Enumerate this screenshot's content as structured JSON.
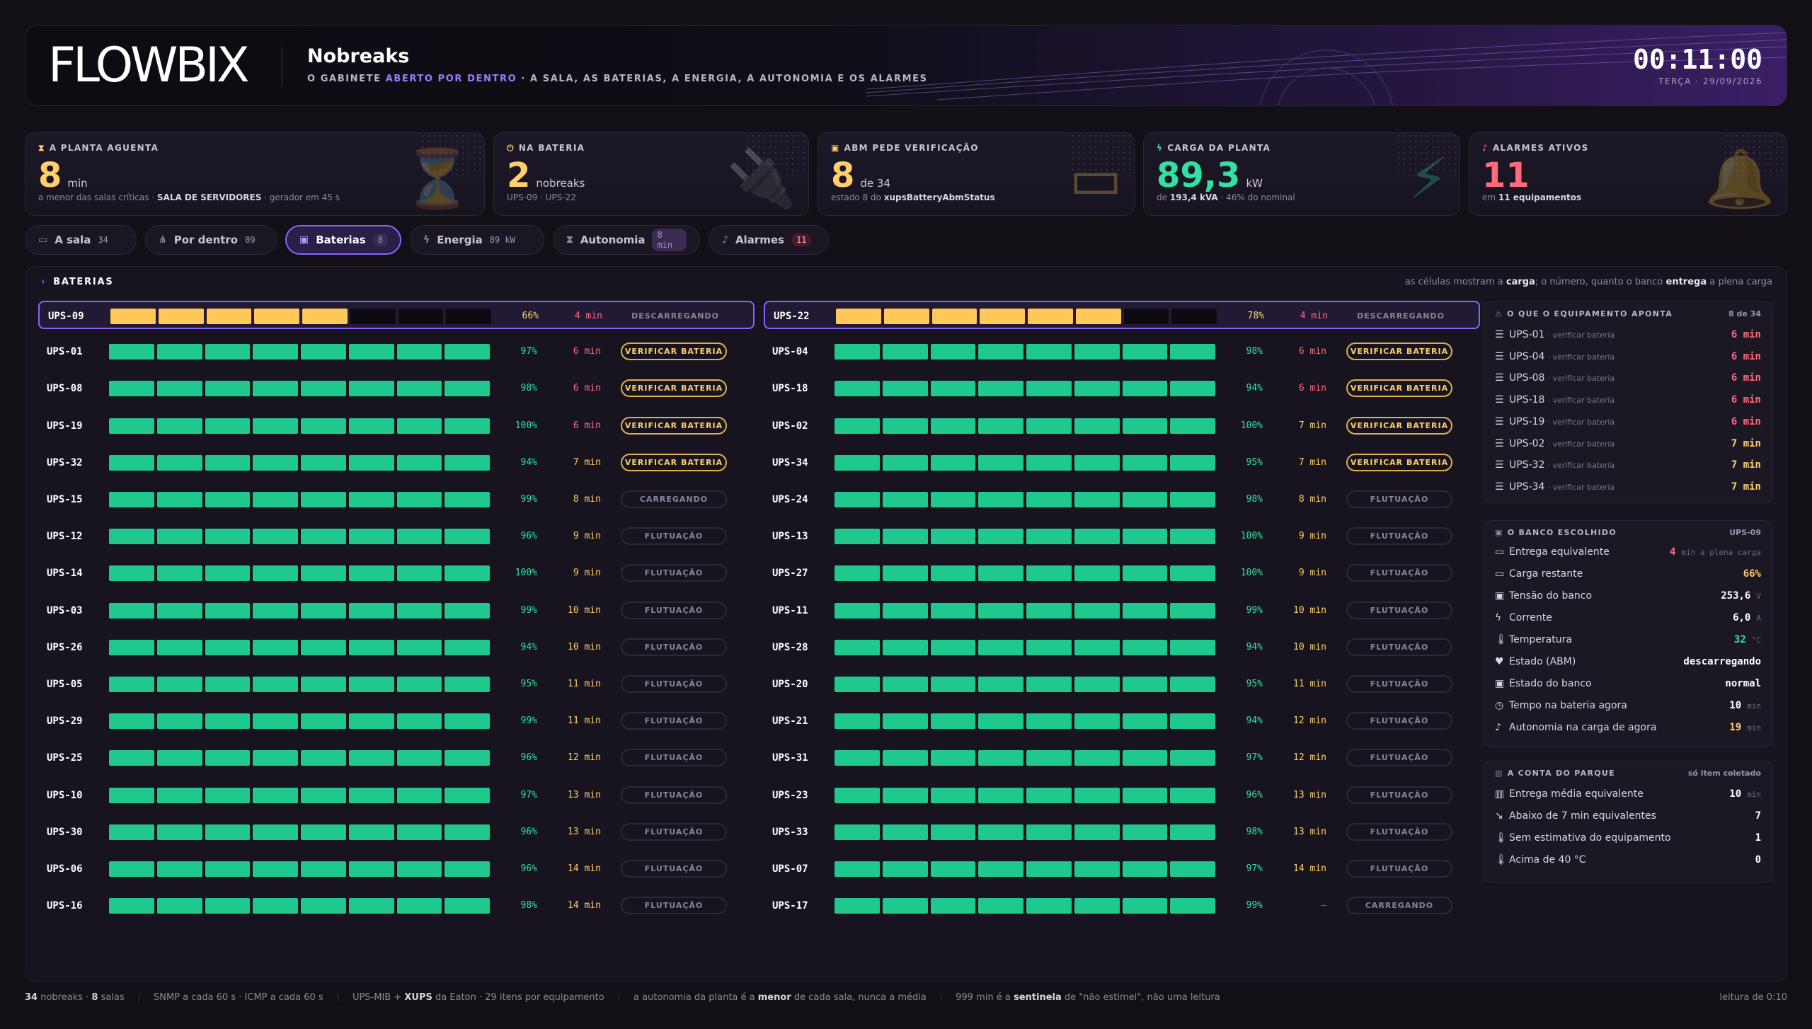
{
  "header": {
    "logo": "FLOWBIX",
    "title": "Nobreaks",
    "subtitle_pre": "O GABINETE ",
    "subtitle_hl": "ABERTO POR DENTRO",
    "subtitle_post": " · A SALA, AS BATERIAS, A ENERGIA, A AUTONOMIA E OS ALARMES",
    "clock": "00:11:00",
    "date": "TERÇA · 29/09/2026"
  },
  "kpis": [
    {
      "label": "A PLANTA AGUENTA",
      "value": "8",
      "unit": "min",
      "note_pre": "a menor das salas críticas · ",
      "note_bold": "SALA DE SERVIDORES",
      "note_post": " · gerador em 45 s",
      "color": "#ffcf6b",
      "icon": "hourglass-icon"
    },
    {
      "label": "NA BATERIA",
      "value": "2",
      "unit": "nobreaks",
      "note_pre": "UPS-09 · UPS-22",
      "note_bold": "",
      "note_post": "",
      "color": "#ffcf6b",
      "icon": "plug-icon"
    },
    {
      "label": "ABM PEDE VERIFICAÇÃO",
      "value": "8",
      "unit": "de 34",
      "note_pre": "estado 8 do ",
      "note_bold": "xupsBatteryAbmStatus",
      "note_post": "",
      "color": "#ffcf6b",
      "icon": "battery-icon"
    },
    {
      "label": "CARGA DA PLANTA",
      "value": "89,3",
      "unit": "kW",
      "note_pre": "de ",
      "note_bold": "193,4 kVA",
      "note_post": " · 46% do nominal",
      "color": "#34e0a1",
      "icon": "bolt-icon"
    },
    {
      "label": "ALARMES ATIVOS",
      "value": "11",
      "unit": "",
      "note_pre": "em ",
      "note_bold": "11 equipamentos",
      "note_post": "",
      "color": "#ff6b7d",
      "icon": "bell-icon"
    }
  ],
  "tabs": [
    {
      "label": "A sala",
      "count": "34",
      "icon": "room-icon"
    },
    {
      "label": "Por dentro",
      "count": "09",
      "icon": "inside-icon"
    },
    {
      "label": "Baterias",
      "count": "8",
      "icon": "battery-icon"
    },
    {
      "label": "Energia",
      "count": "89 kW",
      "icon": "bolt-icon"
    },
    {
      "label": "Autonomia",
      "count": "8 min",
      "icon": "hourglass-icon"
    },
    {
      "label": "Alarmes",
      "count": "11",
      "icon": "bell-icon"
    }
  ],
  "section": {
    "title": "BATERIAS",
    "hint_a": "as células mostram a ",
    "hint_b": "carga",
    "hint_c": "; o número, quanto o banco ",
    "hint_d": "entrega",
    "hint_e": " a plena carga"
  },
  "colors": {
    "green": "#1fc98d",
    "amber": "#ffc857",
    "empty": "#0d0b12",
    "red": "#ff6b7d",
    "accent": "#8a63ff"
  },
  "batteries_left": [
    {
      "name": "UPS-09",
      "charge": 66,
      "filled": 5,
      "pct": "66%",
      "minutes": "4 min",
      "status": "DESCARREGANDO",
      "kind": "desc"
    },
    {
      "name": "UPS-01",
      "charge": 97,
      "filled": 8,
      "pct": "97%",
      "minutes": "6 min",
      "status": "VERIFICAR BATERIA",
      "kind": "warn"
    },
    {
      "name": "UPS-08",
      "charge": 98,
      "filled": 8,
      "pct": "98%",
      "minutes": "6 min",
      "status": "VERIFICAR BATERIA",
      "kind": "warn"
    },
    {
      "name": "UPS-19",
      "charge": 100,
      "filled": 8,
      "pct": "100%",
      "minutes": "6 min",
      "status": "VERIFICAR BATERIA",
      "kind": "warn"
    },
    {
      "name": "UPS-32",
      "charge": 94,
      "filled": 8,
      "pct": "94%",
      "minutes": "7 min",
      "status": "VERIFICAR BATERIA",
      "kind": "warn"
    },
    {
      "name": "UPS-15",
      "charge": 99,
      "filled": 8,
      "pct": "99%",
      "minutes": "8 min",
      "status": "CARREGANDO",
      "kind": "ok"
    },
    {
      "name": "UPS-12",
      "charge": 96,
      "filled": 8,
      "pct": "96%",
      "minutes": "9 min",
      "status": "FLUTUAÇÃO",
      "kind": "ok"
    },
    {
      "name": "UPS-14",
      "charge": 100,
      "filled": 8,
      "pct": "100%",
      "minutes": "9 min",
      "status": "FLUTUAÇÃO",
      "kind": "ok"
    },
    {
      "name": "UPS-03",
      "charge": 99,
      "filled": 8,
      "pct": "99%",
      "minutes": "10 min",
      "status": "FLUTUAÇÃO",
      "kind": "ok"
    },
    {
      "name": "UPS-26",
      "charge": 94,
      "filled": 8,
      "pct": "94%",
      "minutes": "10 min",
      "status": "FLUTUAÇÃO",
      "kind": "ok"
    },
    {
      "name": "UPS-05",
      "charge": 95,
      "filled": 8,
      "pct": "95%",
      "minutes": "11 min",
      "status": "FLUTUAÇÃO",
      "kind": "ok"
    },
    {
      "name": "UPS-29",
      "charge": 99,
      "filled": 8,
      "pct": "99%",
      "minutes": "11 min",
      "status": "FLUTUAÇÃO",
      "kind": "ok"
    },
    {
      "name": "UPS-25",
      "charge": 96,
      "filled": 8,
      "pct": "96%",
      "minutes": "12 min",
      "status": "FLUTUAÇÃO",
      "kind": "ok"
    },
    {
      "name": "UPS-10",
      "charge": 97,
      "filled": 8,
      "pct": "97%",
      "minutes": "13 min",
      "status": "FLUTUAÇÃO",
      "kind": "ok"
    },
    {
      "name": "UPS-30",
      "charge": 96,
      "filled": 8,
      "pct": "96%",
      "minutes": "13 min",
      "status": "FLUTUAÇÃO",
      "kind": "ok"
    },
    {
      "name": "UPS-06",
      "charge": 96,
      "filled": 8,
      "pct": "96%",
      "minutes": "14 min",
      "status": "FLUTUAÇÃO",
      "kind": "ok"
    },
    {
      "name": "UPS-16",
      "charge": 98,
      "filled": 8,
      "pct": "98%",
      "minutes": "14 min",
      "status": "FLUTUAÇÃO",
      "kind": "ok"
    }
  ],
  "batteries_right": [
    {
      "name": "UPS-22",
      "charge": 78,
      "filled": 6,
      "pct": "78%",
      "minutes": "4 min",
      "status": "DESCARREGANDO",
      "kind": "desc"
    },
    {
      "name": "UPS-04",
      "charge": 98,
      "filled": 8,
      "pct": "98%",
      "minutes": "6 min",
      "status": "VERIFICAR BATERIA",
      "kind": "warn"
    },
    {
      "name": "UPS-18",
      "charge": 94,
      "filled": 8,
      "pct": "94%",
      "minutes": "6 min",
      "status": "VERIFICAR BATERIA",
      "kind": "warn"
    },
    {
      "name": "UPS-02",
      "charge": 100,
      "filled": 8,
      "pct": "100%",
      "minutes": "7 min",
      "status": "VERIFICAR BATERIA",
      "kind": "warn"
    },
    {
      "name": "UPS-34",
      "charge": 95,
      "filled": 8,
      "pct": "95%",
      "minutes": "7 min",
      "status": "VERIFICAR BATERIA",
      "kind": "warn"
    },
    {
      "name": "UPS-24",
      "charge": 98,
      "filled": 8,
      "pct": "98%",
      "minutes": "8 min",
      "status": "FLUTUAÇÃO",
      "kind": "ok"
    },
    {
      "name": "UPS-13",
      "charge": 100,
      "filled": 8,
      "pct": "100%",
      "minutes": "9 min",
      "status": "FLUTUAÇÃO",
      "kind": "ok"
    },
    {
      "name": "UPS-27",
      "charge": 100,
      "filled": 8,
      "pct": "100%",
      "minutes": "9 min",
      "status": "FLUTUAÇÃO",
      "kind": "ok"
    },
    {
      "name": "UPS-11",
      "charge": 99,
      "filled": 8,
      "pct": "99%",
      "minutes": "10 min",
      "status": "FLUTUAÇÃO",
      "kind": "ok"
    },
    {
      "name": "UPS-28",
      "charge": 94,
      "filled": 8,
      "pct": "94%",
      "minutes": "10 min",
      "status": "FLUTUAÇÃO",
      "kind": "ok"
    },
    {
      "name": "UPS-20",
      "charge": 95,
      "filled": 8,
      "pct": "95%",
      "minutes": "11 min",
      "status": "FLUTUAÇÃO",
      "kind": "ok"
    },
    {
      "name": "UPS-21",
      "charge": 94,
      "filled": 8,
      "pct": "94%",
      "minutes": "12 min",
      "status": "FLUTUAÇÃO",
      "kind": "ok"
    },
    {
      "name": "UPS-31",
      "charge": 97,
      "filled": 8,
      "pct": "97%",
      "minutes": "12 min",
      "status": "FLUTUAÇÃO",
      "kind": "ok"
    },
    {
      "name": "UPS-23",
      "charge": 96,
      "filled": 8,
      "pct": "96%",
      "minutes": "13 min",
      "status": "FLUTUAÇÃO",
      "kind": "ok"
    },
    {
      "name": "UPS-33",
      "charge": 98,
      "filled": 8,
      "pct": "98%",
      "minutes": "13 min",
      "status": "FLUTUAÇÃO",
      "kind": "ok"
    },
    {
      "name": "UPS-07",
      "charge": 97,
      "filled": 8,
      "pct": "97%",
      "minutes": "14 min",
      "status": "FLUTUAÇÃO",
      "kind": "ok"
    },
    {
      "name": "UPS-17",
      "charge": 99,
      "filled": 8,
      "pct": "99%",
      "minutes": "—",
      "status": "CARREGANDO",
      "kind": "ok"
    }
  ],
  "pointing": {
    "title": "O QUE O EQUIPAMENTO APONTA",
    "count": "8 de 34",
    "items": [
      {
        "name": "UPS-01",
        "note": "· verificar bateria",
        "minutes": "6 min",
        "color": "#ff6b7d"
      },
      {
        "name": "UPS-04",
        "note": "· verificar bateria",
        "minutes": "6 min",
        "color": "#ff6b7d"
      },
      {
        "name": "UPS-08",
        "note": "· verificar bateria",
        "minutes": "6 min",
        "color": "#ff6b7d"
      },
      {
        "name": "UPS-18",
        "note": "· verificar bateria",
        "minutes": "6 min",
        "color": "#ff6b7d"
      },
      {
        "name": "UPS-19",
        "note": "· verificar bateria",
        "minutes": "6 min",
        "color": "#ff6b7d"
      },
      {
        "name": "UPS-02",
        "note": "· verificar bateria",
        "minutes": "7 min",
        "color": "#ffcf6b"
      },
      {
        "name": "UPS-32",
        "note": "· verificar bateria",
        "minutes": "7 min",
        "color": "#ffcf6b"
      },
      {
        "name": "UPS-34",
        "note": "· verificar bateria",
        "minutes": "7 min",
        "color": "#ffcf6b"
      }
    ]
  },
  "chosen": {
    "title": "O BANCO ESCOLHIDO",
    "unit": "UPS-09",
    "items": [
      {
        "label": "Entrega equivalente",
        "value": "4",
        "unit": "min a plena carga",
        "icon": "battery-icon",
        "color": "#ff6b7d"
      },
      {
        "label": "Carga restante",
        "value": "66%",
        "unit": "",
        "icon": "battery-icon",
        "color": "#ffcf6b"
      },
      {
        "label": "Tensão do banco",
        "value": "253,6",
        "unit": "V",
        "icon": "battery-pack-icon",
        "color": "#ffffff"
      },
      {
        "label": "Corrente",
        "value": "6,0",
        "unit": "A",
        "icon": "bolt-icon",
        "color": "#ffffff"
      },
      {
        "label": "Temperatura",
        "value": "32",
        "unit": "°C",
        "icon": "thermometer-icon",
        "color": "#34e0a1"
      },
      {
        "label": "Estado (ABM)",
        "value": "descarregando",
        "unit": "",
        "icon": "heart-pulse-icon",
        "color": "#ffffff"
      },
      {
        "label": "Estado do banco",
        "value": "normal",
        "unit": "",
        "icon": "battery-pack-icon",
        "color": "#ffffff"
      },
      {
        "label": "Tempo na bateria agora",
        "value": "10",
        "unit": "min",
        "icon": "clock-icon",
        "color": "#ffffff"
      },
      {
        "label": "Autonomia na carga de agora",
        "value": "19",
        "unit": "min",
        "icon": "bell-icon",
        "color": "#ffcf6b"
      }
    ]
  },
  "park": {
    "title": "A CONTA DO PARQUE",
    "note": "só item coletado",
    "items": [
      {
        "label": "Entrega média equivalente",
        "value": "10",
        "unit": "min",
        "icon": "bar-chart-icon"
      },
      {
        "label": "Abaixo de 7 min equivalentes",
        "value": "7",
        "unit": "",
        "icon": "trend-down-icon"
      },
      {
        "label": "Sem estimativa do equipamento",
        "value": "1",
        "unit": "",
        "icon": "thermometer-icon"
      },
      {
        "label": "Acima de 40 °C",
        "value": "0",
        "unit": "",
        "icon": "thermometer-icon"
      }
    ]
  },
  "footer": {
    "f1a": "34",
    "f1b": " nobreaks · ",
    "f1c": "8",
    "f1d": " salas",
    "f2": "SNMP a cada 60 s · ICMP a cada 60 s",
    "f3a": "UPS-MIB + ",
    "f3b": "XUPS",
    "f3c": " da Eaton · 29 itens por equipamento",
    "f4a": "a autonomia da planta é a ",
    "f4b": "menor",
    "f4c": " de cada sala, nunca a média",
    "f5a": "999 min é a ",
    "f5b": "sentinela",
    "f5c": " de \"não estimei\", não uma leitura",
    "readtime": "leitura de 0:10"
  }
}
